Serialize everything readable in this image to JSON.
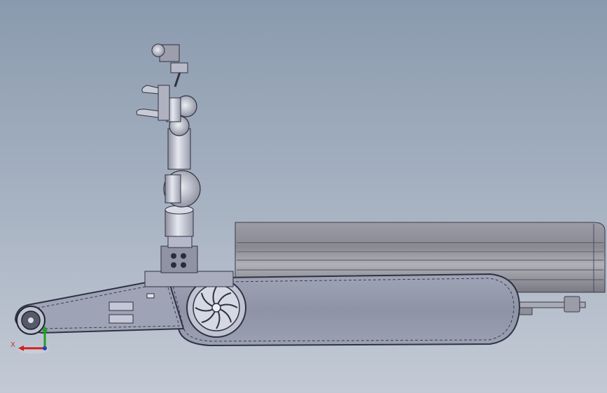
{
  "viewport": {
    "background_top": "#8a9aae",
    "background_bottom": "#c3cad5"
  },
  "model": {
    "description_visible": false,
    "components": [
      "robot-arm",
      "gripper",
      "camera",
      "arm-base-controller",
      "cargo-box",
      "track-assembly",
      "drive-sprocket",
      "idler-wheel",
      "rear-bumper"
    ]
  },
  "triad": {
    "x_label": "X",
    "x_color": "#d02020",
    "y_color": "#20a020"
  }
}
